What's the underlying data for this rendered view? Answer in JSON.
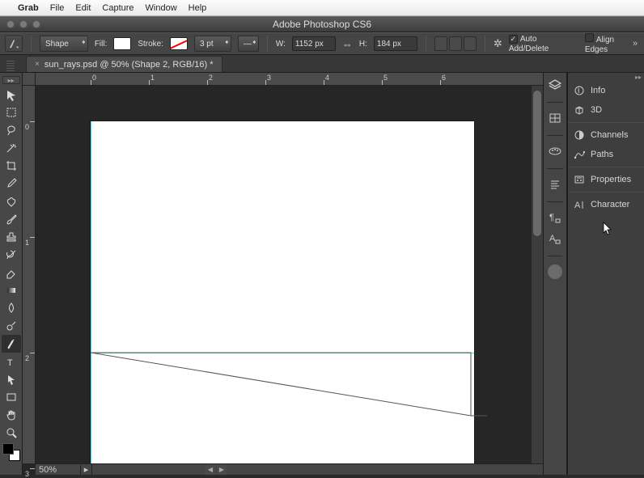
{
  "menubar": {
    "apple": "",
    "app": "Grab",
    "items": [
      "File",
      "Edit",
      "Capture",
      "Window",
      "Help"
    ]
  },
  "window": {
    "title": "Adobe Photoshop CS6"
  },
  "optbar": {
    "mode_label": "Shape",
    "fill_label": "Fill:",
    "stroke_label": "Stroke:",
    "stroke_pt": "3 pt",
    "w_label": "W:",
    "w_value": "1152 px",
    "h_label": "H:",
    "h_value": "184 px",
    "auto_add": "Auto Add/Delete",
    "align_edges": "Align Edges"
  },
  "tab": {
    "label": "sun_rays.psd @ 50% (Shape 2, RGB/16) *"
  },
  "ruler_h": [
    "0",
    "1",
    "2",
    "3",
    "4",
    "5",
    "6"
  ],
  "ruler_v": [
    "0",
    "1",
    "2",
    "3"
  ],
  "status": {
    "zoom": "50%"
  },
  "tools": [
    {
      "name": "move-tool",
      "icon": "move"
    },
    {
      "name": "marquee-tool",
      "icon": "marquee"
    },
    {
      "name": "lasso-tool",
      "icon": "lasso"
    },
    {
      "name": "magic-wand-tool",
      "icon": "wand"
    },
    {
      "name": "crop-tool",
      "icon": "crop"
    },
    {
      "name": "eyedropper-tool",
      "icon": "eyedropper"
    },
    {
      "name": "healing-brush-tool",
      "icon": "heal"
    },
    {
      "name": "brush-tool",
      "icon": "brush"
    },
    {
      "name": "clone-stamp-tool",
      "icon": "stamp"
    },
    {
      "name": "history-brush-tool",
      "icon": "historybrush"
    },
    {
      "name": "eraser-tool",
      "icon": "eraser"
    },
    {
      "name": "gradient-tool",
      "icon": "gradient"
    },
    {
      "name": "blur-tool",
      "icon": "blur"
    },
    {
      "name": "dodge-tool",
      "icon": "dodge"
    },
    {
      "name": "pen-tool",
      "icon": "pen",
      "sel": true
    },
    {
      "name": "type-tool",
      "icon": "type"
    },
    {
      "name": "path-selection-tool",
      "icon": "pathsel"
    },
    {
      "name": "rectangle-tool",
      "icon": "rect"
    },
    {
      "name": "hand-tool",
      "icon": "hand"
    },
    {
      "name": "zoom-tool",
      "icon": "zoom"
    }
  ],
  "rpanel": {
    "items": [
      {
        "name": "info-panel",
        "icon": "ⓘ",
        "label": "Info"
      },
      {
        "name": "3d-panel",
        "icon": "◫",
        "label": "3D"
      },
      {
        "name": "channels-panel",
        "icon": "◐",
        "label": "Channels"
      },
      {
        "name": "paths-panel",
        "icon": "⌁",
        "label": "Paths"
      },
      {
        "name": "properties-panel",
        "icon": "☰",
        "label": "Properties"
      },
      {
        "name": "character-panel",
        "icon": "A|",
        "label": "Character"
      }
    ]
  },
  "iconcol1": [
    {
      "name": "layers-icon",
      "glyph": "layers"
    },
    {
      "name": "adjustments-icon",
      "glyph": "adj"
    },
    {
      "name": "swatches-icon",
      "glyph": "swatch"
    },
    {
      "name": "paragraph-icon",
      "glyph": "para"
    },
    {
      "name": "paragraph-styles-icon",
      "glyph": "parastyles"
    },
    {
      "name": "character-styles-icon",
      "glyph": "charstyles"
    },
    {
      "name": "color-icon",
      "glyph": "circle"
    }
  ]
}
